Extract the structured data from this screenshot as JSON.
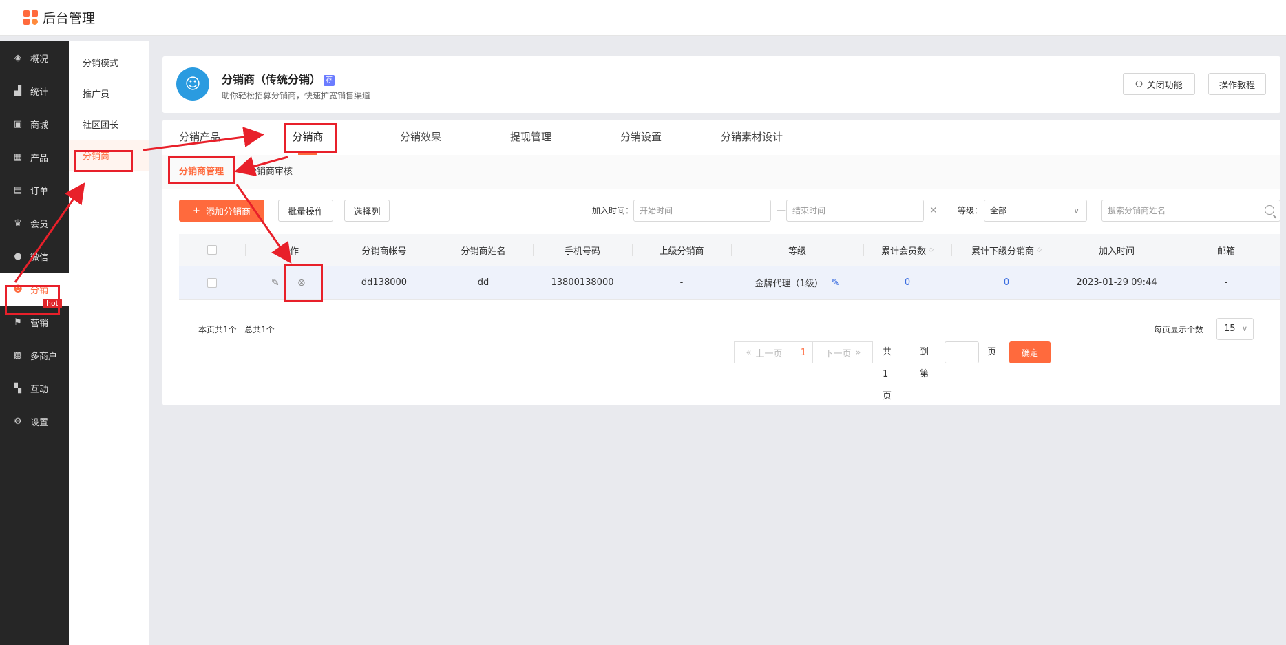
{
  "app": {
    "title": "后台管理"
  },
  "sidebar": {
    "items": [
      {
        "label": "概况",
        "icon": "layers-icon"
      },
      {
        "label": "统计",
        "icon": "chart-icon"
      },
      {
        "label": "商城",
        "icon": "store-icon"
      },
      {
        "label": "产品",
        "icon": "grid-icon"
      },
      {
        "label": "订单",
        "icon": "clipboard-icon"
      },
      {
        "label": "会员",
        "icon": "crown-icon"
      },
      {
        "label": "微信",
        "icon": "wechat-icon"
      },
      {
        "label": "分销",
        "icon": "distribution-user-icon",
        "badge": "hot",
        "active": true
      },
      {
        "label": "营销",
        "icon": "flag-icon"
      },
      {
        "label": "多商户",
        "icon": "merchant-icon"
      },
      {
        "label": "互动",
        "icon": "apps-icon"
      },
      {
        "label": "设置",
        "icon": "gear-icon"
      }
    ]
  },
  "subsidebar": {
    "items": [
      {
        "label": "分销模式"
      },
      {
        "label": "推广员"
      },
      {
        "label": "社区团长"
      },
      {
        "label": "分销商",
        "active": true
      }
    ]
  },
  "header": {
    "title": "分销商（传统分销）",
    "badge": "荐",
    "subtitle": "助你轻松招募分销商，快速扩宽销售渠道",
    "close_btn": "关闭功能",
    "tutorial_btn": "操作教程"
  },
  "tabs": [
    {
      "label": "分销产品"
    },
    {
      "label": "分销商",
      "active": true
    },
    {
      "label": "分销效果"
    },
    {
      "label": "提现管理"
    },
    {
      "label": "分销设置"
    },
    {
      "label": "分销素材设计"
    }
  ],
  "subtabs": [
    {
      "label": "分销商管理",
      "active": true
    },
    {
      "label": "分销商审核"
    }
  ],
  "toolbar": {
    "add_btn": "添加分销商",
    "batch_btn": "批量操作",
    "columns_btn": "选择列",
    "join_time_label": "加入时间：",
    "start_placeholder": "开始时间",
    "end_placeholder": "结束时间",
    "level_label": "等级：",
    "level_value": "全部",
    "search_placeholder": "搜索分销商姓名"
  },
  "table": {
    "headers": [
      "操作",
      "分销商帐号",
      "分销商姓名",
      "手机号码",
      "上级分销商",
      "等级",
      "累计会员数",
      "累计下级分销商",
      "加入时间",
      "邮箱"
    ],
    "rows": [
      {
        "account": "dd138000",
        "name": "dd",
        "phone": "13800138000",
        "parent": "-",
        "level": "金牌代理（1级）",
        "members": "0",
        "sub_distributors": "0",
        "join_time": "2023-01-29 09:44",
        "email": "-"
      }
    ]
  },
  "pagination": {
    "page_info": "本页共1个   总共1个",
    "prev": "上一页",
    "current": "1",
    "next": "下一页",
    "total_pages": "共1页",
    "goto_label": "到第",
    "page_unit": "页",
    "confirm": "确定",
    "per_page_label": "每页显示个数",
    "per_page_value": "15"
  },
  "colors": {
    "accent": "#ff6a3d",
    "annotation": "#e8202a",
    "link": "#3a6de0",
    "sidebar_bg": "#262626"
  }
}
